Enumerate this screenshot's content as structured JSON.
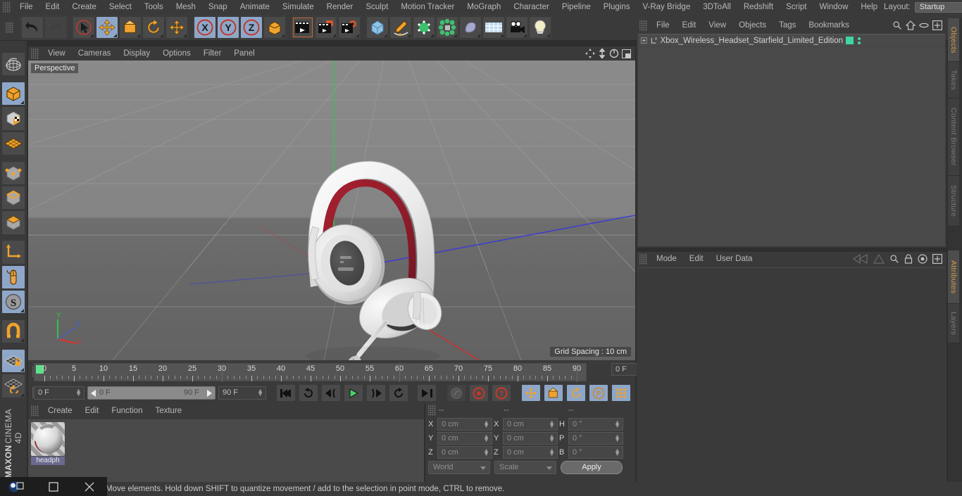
{
  "app": {
    "title": "MAXON CINEMA 4D",
    "brand_bold": "MAXON",
    "brand_light": "CINEMA 4D"
  },
  "main_menu": {
    "items": [
      "File",
      "Edit",
      "Create",
      "Select",
      "Tools",
      "Mesh",
      "Snap",
      "Animate",
      "Simulate",
      "Render",
      "Sculpt",
      "Motion Tracker",
      "MoGraph",
      "Character",
      "Pipeline",
      "Plugins",
      "V-Ray Bridge",
      "3DToAll",
      "Redshift",
      "Script",
      "Window",
      "Help"
    ],
    "layout_label": "Layout:",
    "layout_value": "Startup",
    "search_icon": "search-icon"
  },
  "toolbar": {
    "groups": [
      {
        "name": "undo-redo",
        "buttons": [
          {
            "icon": "undo-icon",
            "label": "Undo",
            "active": false
          },
          {
            "icon": "redo-icon",
            "label": "Redo",
            "active": false
          }
        ]
      },
      {
        "name": "transform-tools",
        "buttons": [
          {
            "icon": "select-live-icon",
            "label": "Live Selection",
            "active": false
          },
          {
            "icon": "move-icon",
            "label": "Move",
            "active": true
          },
          {
            "icon": "scale-icon",
            "label": "Scale",
            "active": false
          },
          {
            "icon": "rotate-icon",
            "label": "Rotate",
            "active": false
          },
          {
            "icon": "move-dup-icon",
            "label": "Move",
            "active": false
          }
        ]
      },
      {
        "name": "axis-locks",
        "buttons": [
          {
            "icon": "axis-x-icon",
            "label": "X Axis",
            "active": true
          },
          {
            "icon": "axis-y-icon",
            "label": "Y Axis",
            "active": true
          },
          {
            "icon": "axis-z-icon",
            "label": "Z Axis",
            "active": true
          },
          {
            "icon": "world-coord-icon",
            "label": "World/Object",
            "active": false
          }
        ]
      },
      {
        "name": "render-tools",
        "buttons": [
          {
            "icon": "render-view-icon",
            "label": "Render View",
            "active": false
          },
          {
            "icon": "render-picture-icon",
            "label": "Render to Picture Viewer",
            "active": false
          },
          {
            "icon": "render-settings-icon",
            "label": "Edit Render Settings",
            "active": false
          }
        ]
      },
      {
        "name": "create-objects",
        "buttons": [
          {
            "icon": "cube-icon",
            "label": "Add Cube Object",
            "active": false
          },
          {
            "icon": "spline-pen-icon",
            "label": "Add Spline",
            "active": false
          },
          {
            "icon": "nurbs-icon",
            "label": "Add Generator",
            "active": false
          },
          {
            "icon": "array-icon",
            "label": "Add Array Object",
            "active": false
          },
          {
            "icon": "deformer-icon",
            "label": "Add Bend Object",
            "active": false
          },
          {
            "icon": "floor-icon",
            "label": "Add Floor Object",
            "active": false
          },
          {
            "icon": "camera-icon",
            "label": "Add Camera Object",
            "active": false
          },
          {
            "icon": "light-icon",
            "label": "Add Light Object",
            "active": false
          }
        ]
      }
    ]
  },
  "left_toolbar": {
    "buttons": [
      {
        "icon": "globe-wire-icon",
        "label": "Make Editable",
        "active": false
      },
      {
        "icon": "model-mode-icon",
        "label": "Model Mode",
        "active": true
      },
      {
        "icon": "texture-mode-icon",
        "label": "Texture Mode",
        "active": false
      },
      {
        "icon": "polygon-grid-icon",
        "label": "Workplane",
        "active": false
      },
      {
        "icon": "points-mode-icon",
        "label": "Points Mode",
        "active": false
      },
      {
        "icon": "edges-mode-icon",
        "label": "Edges Mode",
        "active": false
      },
      {
        "icon": "polygons-mode-icon",
        "label": "Polygons Mode",
        "active": false
      },
      {
        "icon": "axis-modify-icon",
        "label": "Enable Axis Modification",
        "active": false
      },
      {
        "icon": "viewport-solo-icon",
        "label": "Viewport Solo Single",
        "active": true
      },
      {
        "icon": "snap-s-icon",
        "label": "Enable Snapping",
        "active": true
      },
      {
        "icon": "magnet-icon",
        "label": "Magnet",
        "active": false
      },
      {
        "icon": "workplane-lock-icon",
        "label": "Lock Workplane",
        "active": true
      },
      {
        "icon": "workplane-rotate-icon",
        "label": "Planar Workplane",
        "active": false
      }
    ]
  },
  "viewport": {
    "menu": [
      "View",
      "Cameras",
      "Display",
      "Options",
      "Filter",
      "Panel"
    ],
    "corner_icons": [
      "pan-icon",
      "dolly-icon",
      "rotate-view-icon",
      "maximize-icon"
    ],
    "label": "Perspective",
    "grid_spacing": "Grid Spacing : 10 cm",
    "axis_gizmo": {
      "x": "X",
      "y": "Y",
      "z": "Z"
    },
    "model_name": "Xbox Wireless Headset"
  },
  "timeline": {
    "ticks": [
      0,
      5,
      10,
      15,
      20,
      25,
      30,
      35,
      40,
      45,
      50,
      55,
      60,
      65,
      70,
      75,
      80,
      85,
      90
    ],
    "current_frame": "0 F",
    "range_start": "0 F",
    "range_end": "90 F",
    "end_frame": "90 F",
    "right_frame": "0 F",
    "transport": [
      {
        "icon": "goto-start-icon",
        "label": "Go to Start",
        "active": false
      },
      {
        "icon": "play-back-loop-icon",
        "label": "Play Reverse",
        "active": false
      },
      {
        "icon": "step-back-icon",
        "label": "Step Back",
        "active": false
      },
      {
        "icon": "play-icon",
        "label": "Play",
        "active": false
      },
      {
        "icon": "step-forward-icon",
        "label": "Step Forward",
        "active": false
      },
      {
        "icon": "loop-forward-icon",
        "label": "Play Forward",
        "active": false
      },
      {
        "icon": "goto-end-icon",
        "label": "Go to End",
        "active": false
      }
    ],
    "record": [
      {
        "icon": "autokey-icon",
        "label": "Autokeying",
        "active": false
      },
      {
        "icon": "record-icon",
        "label": "Record Active Objects",
        "active": false
      },
      {
        "icon": "keyframe-select-icon",
        "label": "Keyframe Selection",
        "active": false
      }
    ],
    "key_toggles": [
      {
        "icon": "key-position-icon",
        "label": "Position",
        "active": true
      },
      {
        "icon": "key-scale-icon",
        "label": "Scale",
        "active": true
      },
      {
        "icon": "key-rotation-icon",
        "label": "Rotation",
        "active": true
      },
      {
        "icon": "key-param-icon",
        "label": "Parameter",
        "active": true
      },
      {
        "icon": "key-pla-icon",
        "label": "Point Level Animation",
        "active": true
      },
      {
        "icon": "timeline-filmstrip-icon",
        "label": "Timeline",
        "active": true
      }
    ]
  },
  "material_manager": {
    "menu": [
      "Create",
      "Edit",
      "Function",
      "Texture"
    ],
    "materials": [
      {
        "name": "headph",
        "thumb": "headphone-material-sphere"
      }
    ]
  },
  "coordinates": {
    "headers": [
      "--",
      "--",
      "--"
    ],
    "rows": [
      {
        "pos_label": "X",
        "pos_value": "0 cm",
        "size_label": "X",
        "size_value": "0 cm",
        "rot_label": "H",
        "rot_value": "0 °"
      },
      {
        "pos_label": "Y",
        "pos_value": "0 cm",
        "size_label": "Y",
        "size_value": "0 cm",
        "rot_label": "P",
        "rot_value": "0 °"
      },
      {
        "pos_label": "Z",
        "pos_value": "0 cm",
        "size_label": "Z",
        "size_value": "0 cm",
        "rot_label": "B",
        "rot_value": "0 °"
      }
    ],
    "coord_system": "World",
    "size_mode": "Scale",
    "apply_label": "Apply"
  },
  "object_manager": {
    "menu": [
      "File",
      "Edit",
      "View",
      "Objects",
      "Tags",
      "Bookmarks"
    ],
    "header_icons": [
      "search-icon",
      "home-icon",
      "ellipse-icon",
      "plus-box-icon"
    ],
    "objects": [
      {
        "name": "Xbox_Wireless_Headset_Starfield_Limited_Edition",
        "layer": "0",
        "visible_color": "#3fd6a0",
        "expandable": true
      }
    ]
  },
  "attribute_manager": {
    "menu": [
      "Mode",
      "Edit",
      "User Data"
    ],
    "header_icons": [
      "history-back-icon",
      "history-forward-icon",
      "search-icon",
      "lock-icon",
      "target-icon",
      "plus-box-icon"
    ]
  },
  "side_tabs": [
    {
      "label": "Objects",
      "selected": true
    },
    {
      "label": "Takes",
      "selected": false
    },
    {
      "label": "Content Browser",
      "selected": false
    },
    {
      "label": "Structure",
      "selected": false
    },
    {
      "label": "Attributes",
      "selected": true
    },
    {
      "label": "Layers",
      "selected": false
    }
  ],
  "status_bar": {
    "text": "Move elements. Hold down SHIFT to quantize movement / add to the selection in point mode, CTRL to remove."
  },
  "taskbar": {
    "buttons": [
      {
        "icon": "app-window-icon",
        "label": "Cinema 4D"
      },
      {
        "icon": "maximize-square-icon",
        "label": "Maximize"
      },
      {
        "icon": "close-x-icon",
        "label": "Close"
      }
    ]
  },
  "colors": {
    "accent_orange": "#e08b2a",
    "panel_bg": "#3a3a3a",
    "viewport_bg": "#7a7a7a",
    "green": "#3fd6a0",
    "headset_red": "#9e2030",
    "headset_white": "#e8e8e8"
  }
}
